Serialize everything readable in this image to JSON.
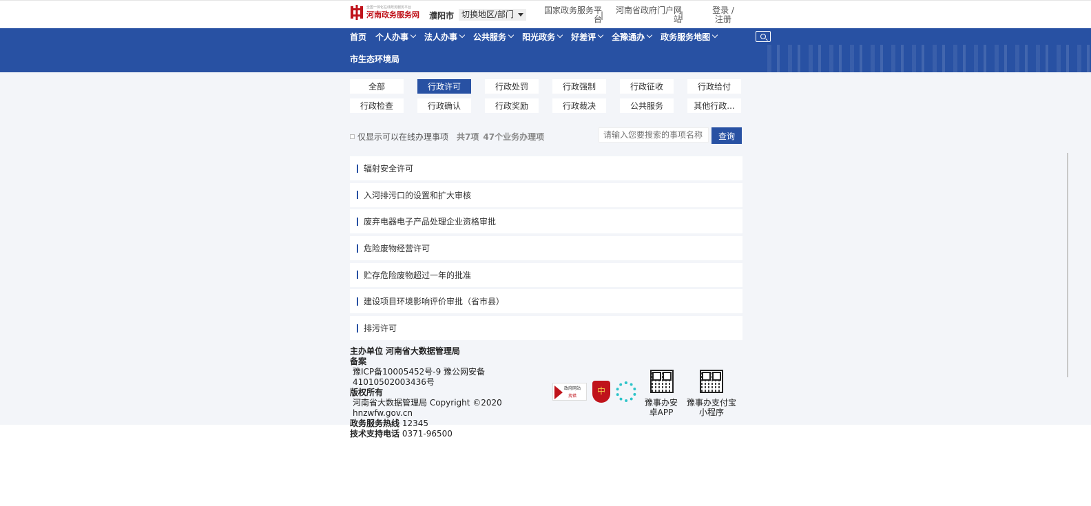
{
  "header": {
    "logo_sub": "全国一体化在线政务服务平台",
    "logo_main": "河南政务服务网",
    "city": "濮阳市",
    "switch_label": "切换地区/部门",
    "link_national": "国家政务服务平台",
    "link_portal": "河南省政府门户网站",
    "link_login": "登录 / 注册",
    "sep": "|"
  },
  "nav": {
    "items": [
      "首页",
      "个人办事",
      "法人办事",
      "公共服务",
      "阳光政务",
      "好差评",
      "全豫通办",
      "政务服务地图"
    ],
    "dept": "市生态环境局"
  },
  "filters": {
    "items": [
      "全部",
      "行政许可",
      "行政处罚",
      "行政强制",
      "行政征收",
      "行政给付",
      "行政检查",
      "行政确认",
      "行政奖励",
      "行政裁决",
      "公共服务",
      "其他行政..."
    ],
    "active_index": 1
  },
  "options": {
    "online_only": "仅显示可以在线办理事项",
    "count_items": "共7项",
    "count_business": "47个业务办理项",
    "search_placeholder": "请输入您要搜索的事项名称",
    "search_button": "查询"
  },
  "items": [
    "辐射安全许可",
    "入河排污口的设置和扩大审核",
    "废弃电器电子产品处理企业资格审批",
    "危险废物经营许可",
    "贮存危险废物超过一年的批准",
    "建设项目环境影响评价审批（省市县）",
    "排污许可"
  ],
  "footer": {
    "host_label": "主办单位",
    "host_value": "河南省大数据管理局",
    "record_label": "备案",
    "record_value_1": "豫ICP备10005452号-9  豫公网安备",
    "record_value_2": "41010502003436号",
    "copyright_label": "版权所有",
    "copyright_value_1": "河南省大数据管理局 Copyright ©2020",
    "copyright_value_2": "hnzwfw.gov.cn",
    "hotline_label": "政务服务热线",
    "hotline_value": "12345",
    "support_label": "技术支持电话",
    "support_value": "0371-96500",
    "badge_gov_1": "政府网站",
    "badge_gov_2": "找错",
    "qr_android": "豫事办安卓APP",
    "qr_alipay": "豫事办支付宝小程序"
  },
  "colors": {
    "primary": "#2851a3",
    "brand_red": "#c0131b",
    "page_bg": "#f3f5f9"
  }
}
